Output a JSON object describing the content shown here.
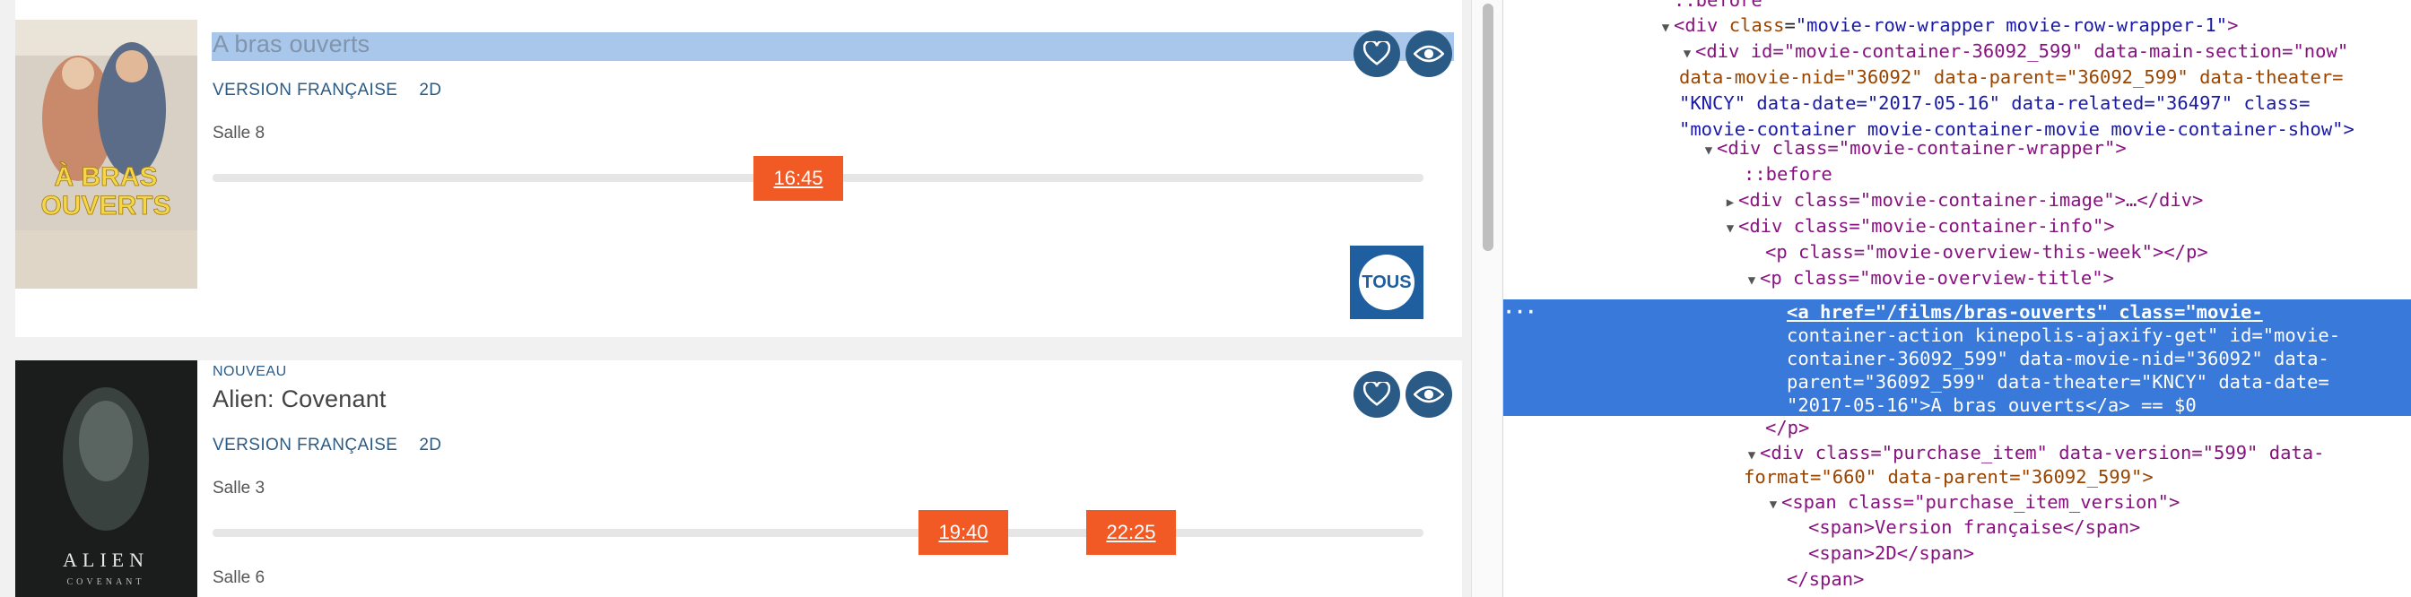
{
  "website": {
    "movies": [
      {
        "title": "A bras ouverts",
        "poster_line1": "À BRAS",
        "poster_line2": "OUVERTS",
        "version": "VERSION FRANÇAISE",
        "format": "2D",
        "rooms": [
          {
            "name": "Salle 8",
            "times": [
              "16:45"
            ]
          }
        ],
        "extra_badge": "TOUS"
      },
      {
        "badge": "NOUVEAU",
        "title": "Alien: Covenant",
        "poster_line1": "ALIEN",
        "poster_line2": "COVENANT",
        "version": "VERSION FRANÇAISE",
        "format": "2D",
        "rooms": [
          {
            "name": "Salle 3",
            "times": [
              "19:40",
              "22:25"
            ]
          },
          {
            "name": "Salle 6",
            "times": []
          }
        ]
      }
    ],
    "colors": {
      "accent": "#f15a24",
      "brand": "#2a5b87",
      "selection": "#a9c7ea"
    },
    "icons": {
      "favorite": "heart-icon",
      "watchlist": "eye-icon"
    }
  },
  "devtools": {
    "lines": {
      "l0": "::before",
      "l1_tag": "div",
      "l1_attr": "class",
      "l1_val": "\"movie-row-wrapper movie-row-wrapper-1\"",
      "l2a": "<div id=\"movie-container-36092_599\" data-main-section=\"now\"",
      "l2b": "data-movie-nid=\"36092\" data-parent=\"36092_599\" data-theater=",
      "l2c": "\"KNCY\" data-date=\"2017-05-16\" data-related=\"36497\" class=",
      "l2d": "\"movie-container movie-container-movie movie-container-show\">",
      "l3": "<div class=\"movie-container-wrapper\">",
      "l4": "::before",
      "l5": "<div class=\"movie-container-image\">…</div>",
      "l6": "<div class=\"movie-container-info\">",
      "l7": "<p class=\"movie-overview-this-week\"></p>",
      "l8": "<p class=\"movie-overview-title\">",
      "s1": "<a href=\"/films/bras-ouverts\" class=\"movie-",
      "s2": "container-action kinepolis-ajaxify-get\" id=\"movie-",
      "s3": "container-36092_599\" data-movie-nid=\"36092\" data-",
      "s4": "parent=\"36092_599\" data-theater=\"KNCY\" data-date=",
      "s5": "\"2017-05-16\">A bras ouverts</a> == $0",
      "l9": "</p>",
      "l10a": "<div class=\"purchase_item\" data-version=\"599\" data-",
      "l10b": "format=\"660\" data-parent=\"36092_599\">",
      "l11": "<span class=\"purchase_item_version\">",
      "l12": "<span>Version française</span>",
      "l13": "<span>2D</span>",
      "l14": "</span>"
    }
  }
}
